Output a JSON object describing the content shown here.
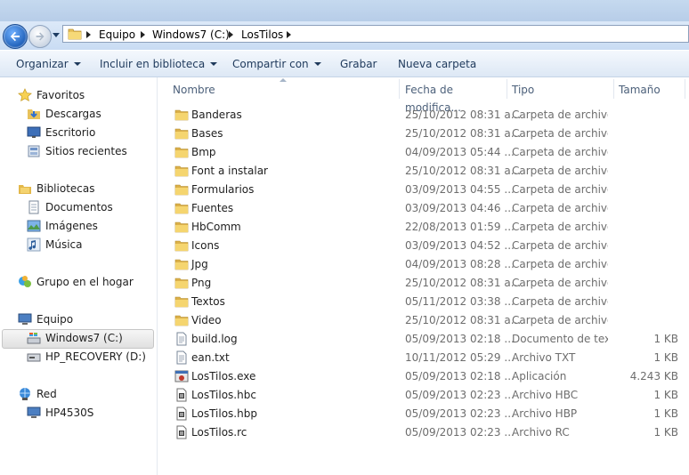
{
  "address": {
    "crumbs": [
      "Equipo",
      "Windows7 (C:)",
      "LosTilos"
    ]
  },
  "toolbar": {
    "organize": "Organizar",
    "include": "Incluir en biblioteca",
    "share": "Compartir con",
    "burn": "Grabar",
    "new_folder": "Nueva carpeta"
  },
  "nav": {
    "favorites": "Favoritos",
    "downloads": "Descargas",
    "desktop": "Escritorio",
    "recent": "Sitios recientes",
    "libraries": "Bibliotecas",
    "documents": "Documentos",
    "images": "Imágenes",
    "music": "Música",
    "homegroup": "Grupo en el hogar",
    "computer": "Equipo",
    "drive_c": "Windows7 (C:)",
    "drive_d": "HP_RECOVERY (D:)",
    "network": "Red",
    "pc": "HP4530S"
  },
  "columns": {
    "name": "Nombre",
    "date": "Fecha de modifica...",
    "type": "Tipo",
    "size": "Tamaño"
  },
  "files": [
    {
      "name": "Banderas",
      "date": "25/10/2012 08:31 a...",
      "type": "Carpeta de archivos",
      "size": "",
      "icon": "folder-icon"
    },
    {
      "name": "Bases",
      "date": "25/10/2012 08:31 a...",
      "type": "Carpeta de archivos",
      "size": "",
      "icon": "folder-icon"
    },
    {
      "name": "Bmp",
      "date": "04/09/2013 05:44 ...",
      "type": "Carpeta de archivos",
      "size": "",
      "icon": "folder-icon"
    },
    {
      "name": "Font a instalar",
      "date": "25/10/2012 08:31 a...",
      "type": "Carpeta de archivos",
      "size": "",
      "icon": "folder-icon"
    },
    {
      "name": "Formularios",
      "date": "03/09/2013 04:55 ...",
      "type": "Carpeta de archivos",
      "size": "",
      "icon": "folder-icon"
    },
    {
      "name": "Fuentes",
      "date": "03/09/2013 04:46 ...",
      "type": "Carpeta de archivos",
      "size": "",
      "icon": "folder-icon"
    },
    {
      "name": "HbComm",
      "date": "22/08/2013 01:59 ...",
      "type": "Carpeta de archivos",
      "size": "",
      "icon": "folder-icon"
    },
    {
      "name": "Icons",
      "date": "03/09/2013 04:52 ...",
      "type": "Carpeta de archivos",
      "size": "",
      "icon": "folder-icon"
    },
    {
      "name": "Jpg",
      "date": "04/09/2013 08:28 ...",
      "type": "Carpeta de archivos",
      "size": "",
      "icon": "folder-icon"
    },
    {
      "name": "Png",
      "date": "25/10/2012 08:31 a...",
      "type": "Carpeta de archivos",
      "size": "",
      "icon": "folder-icon"
    },
    {
      "name": "Textos",
      "date": "05/11/2012 03:38 ...",
      "type": "Carpeta de archivos",
      "size": "",
      "icon": "folder-icon"
    },
    {
      "name": "Video",
      "date": "25/10/2012 08:31 a...",
      "type": "Carpeta de archivos",
      "size": "",
      "icon": "folder-icon"
    },
    {
      "name": "build.log",
      "date": "05/09/2013 02:18 ...",
      "type": "Documento de tex...",
      "size": "1 KB",
      "icon": "text-file-icon"
    },
    {
      "name": "ean.txt",
      "date": "10/11/2012 05:29 ...",
      "type": "Archivo TXT",
      "size": "1 KB",
      "icon": "text-file-icon"
    },
    {
      "name": "LosTilos.exe",
      "date": "05/09/2013 02:18 ...",
      "type": "Aplicación",
      "size": "4.243 KB",
      "icon": "exe-icon"
    },
    {
      "name": "LosTilos.hbc",
      "date": "05/09/2013 02:23 ...",
      "type": "Archivo HBC",
      "size": "1 KB",
      "icon": "hb-file-icon"
    },
    {
      "name": "LosTilos.hbp",
      "date": "05/09/2013 02:23 ...",
      "type": "Archivo HBP",
      "size": "1 KB",
      "icon": "hb-file-icon"
    },
    {
      "name": "LosTilos.rc",
      "date": "05/09/2013 02:23 ...",
      "type": "Archivo RC",
      "size": "1 KB",
      "icon": "hb-file-icon"
    }
  ]
}
